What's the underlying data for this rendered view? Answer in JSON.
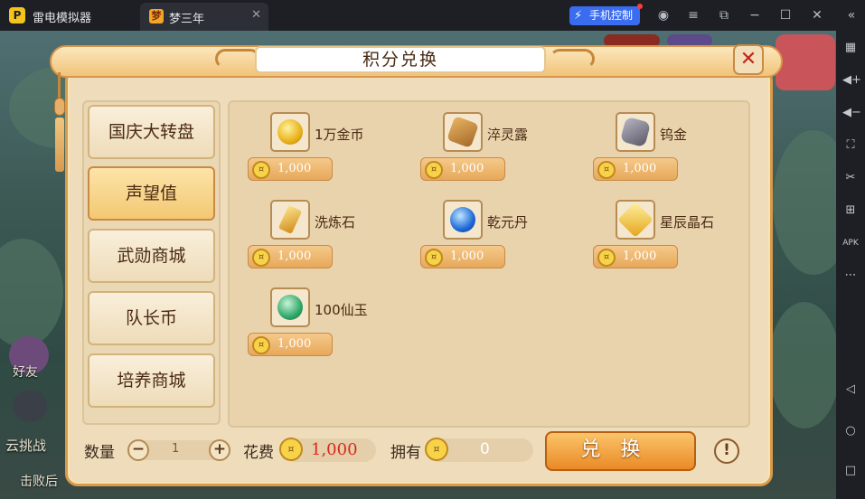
{
  "emulator": {
    "app_name": "雷电模拟器",
    "tab_label": "梦三年",
    "phone_control_label": "手机控制",
    "accent_color": "#3a6cf0"
  },
  "game_bg": {
    "friend_label": "好友",
    "challenge_label": "云挑战",
    "defeat_label": "击败后"
  },
  "dialog": {
    "title": "积分兑换",
    "close_glyph": "✕"
  },
  "categories": [
    {
      "label": "国庆大转盘",
      "active": false
    },
    {
      "label": "声望值",
      "active": true
    },
    {
      "label": "武勋商城",
      "active": false
    },
    {
      "label": "队长币",
      "active": false
    },
    {
      "label": "培养商城",
      "active": false
    }
  ],
  "items": [
    {
      "name": "1万金币",
      "price": "1,000",
      "icon": "gold-coin-icon"
    },
    {
      "name": "淬灵露",
      "price": "1,000",
      "icon": "potion-jar-icon"
    },
    {
      "name": "钨金",
      "price": "1,000",
      "icon": "tungsten-ore-icon"
    },
    {
      "name": "洗炼石",
      "price": "1,000",
      "icon": "refine-stone-icon"
    },
    {
      "name": "乾元丹",
      "price": "1,000",
      "icon": "blue-pill-icon"
    },
    {
      "name": "星辰晶石",
      "price": "1,000",
      "icon": "star-crystal-icon"
    },
    {
      "name": "100仙玉",
      "price": "1,000",
      "icon": "jade-icon"
    }
  ],
  "footer": {
    "quantity_label": "数量",
    "quantity_value": "1",
    "minus_glyph": "−",
    "plus_glyph": "+",
    "cost_label": "花费",
    "cost_value": "1,000",
    "own_label": "拥有",
    "own_value": "0",
    "exchange_label": "兑换",
    "info_glyph": "!"
  }
}
